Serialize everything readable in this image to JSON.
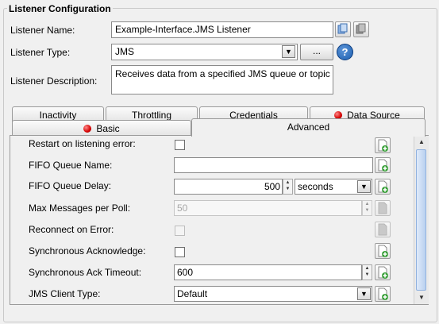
{
  "section": {
    "title": "Listener Configuration"
  },
  "listener": {
    "name_label": "Listener Name:",
    "name_value": "Example-Interface.JMS Listener",
    "type_label": "Listener Type:",
    "type_value": "JMS",
    "browse_label": "...",
    "help_label": "?",
    "description_label": "Listener Description:",
    "description_value": "Receives data from a specified JMS queue or topic"
  },
  "tabs": {
    "row1": [
      "Inactivity",
      "Throttling",
      "Credentials",
      "Data Source"
    ],
    "row2": [
      "Basic",
      "Advanced"
    ],
    "active": "Advanced",
    "error_tabs": [
      "Data Source",
      "Basic"
    ]
  },
  "advanced": {
    "restart_label": "Restart on listening error:",
    "restart_checked": false,
    "fifo_name_label": "FIFO Queue Name:",
    "fifo_name_value": "",
    "fifo_delay_label": "FIFO Queue Delay:",
    "fifo_delay_value": "500",
    "fifo_delay_unit": "seconds",
    "max_messages_label": "Max Messages per Poll:",
    "max_messages_value": "50",
    "reconnect_label": "Reconnect on Error:",
    "reconnect_checked": false,
    "sync_ack_label": "Synchronous Acknowledge:",
    "sync_ack_checked": false,
    "sync_timeout_label": "Synchronous Ack Timeout:",
    "sync_timeout_value": "600",
    "client_type_label": "JMS Client Type:",
    "client_type_value": "Default"
  },
  "colors": {
    "accent": "#1c5fb0",
    "error": "#d40000",
    "scroll": "#c3d7f1"
  }
}
